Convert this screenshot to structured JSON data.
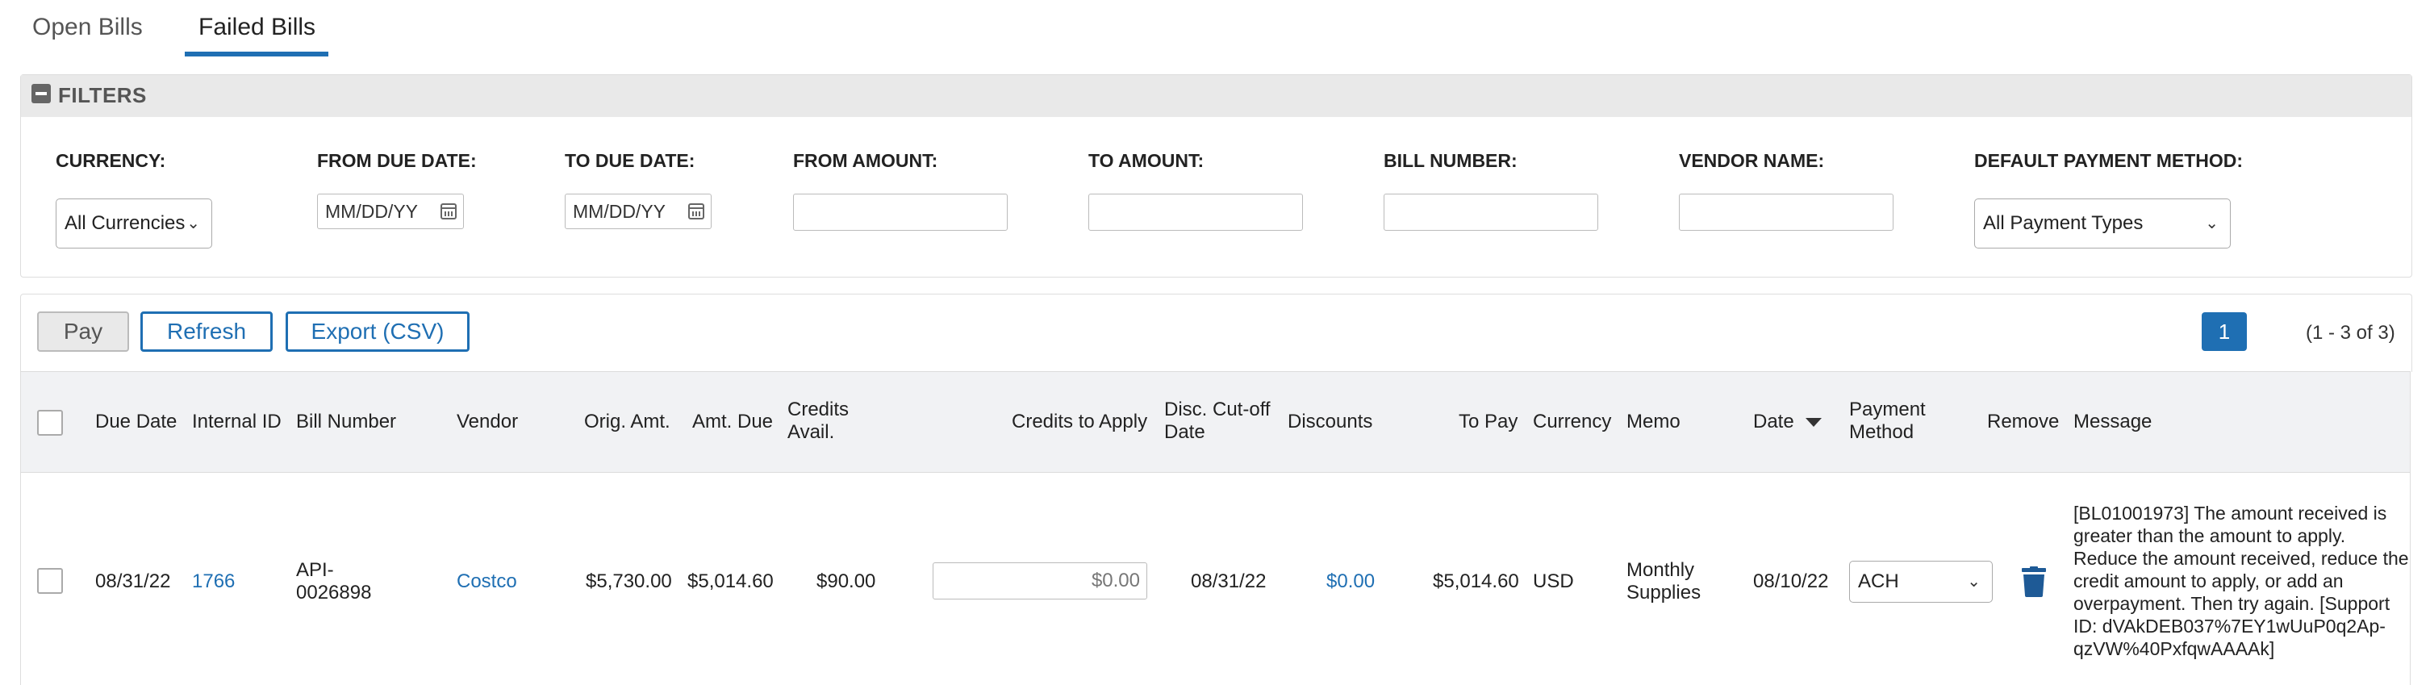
{
  "tabs": [
    {
      "label": "Open Bills",
      "active": false
    },
    {
      "label": "Failed Bills",
      "active": true
    }
  ],
  "filters": {
    "title": "FILTERS",
    "currency_label": "CURRENCY:",
    "currency_value": "All Currencies",
    "from_due_label": "FROM DUE DATE:",
    "from_due_placeholder": "MM/DD/YY",
    "to_due_label": "TO DUE DATE:",
    "to_due_placeholder": "MM/DD/YY",
    "from_amount_label": "FROM AMOUNT:",
    "to_amount_label": "TO AMOUNT:",
    "bill_number_label": "BILL NUMBER:",
    "vendor_name_label": "VENDOR NAME:",
    "payment_method_label": "DEFAULT PAYMENT METHOD:",
    "payment_method_value": "All Payment Types"
  },
  "toolbar": {
    "pay_label": "Pay",
    "refresh_label": "Refresh",
    "export_label": "Export (CSV)",
    "current_page": "1",
    "range_text": "(1 - 3 of 3)"
  },
  "table": {
    "headers": {
      "due_date": "Due Date",
      "internal_id": "Internal ID",
      "bill_number": "Bill Number",
      "vendor": "Vendor",
      "orig_amt": "Orig. Amt.",
      "amt_due": "Amt. Due",
      "credits_avail_1": "Credits",
      "credits_avail_2": "Avail.",
      "credits_to_apply": "Credits to Apply",
      "disc_cutoff_1": "Disc. Cut-off",
      "disc_cutoff_2": "Date",
      "discounts": "Discounts",
      "to_pay": "To Pay",
      "currency": "Currency",
      "memo": "Memo",
      "date": "Date",
      "payment_method_1": "Payment",
      "payment_method_2": "Method",
      "remove": "Remove",
      "message": "Message"
    },
    "rows": [
      {
        "due_date": "08/31/22",
        "internal_id": "1766",
        "bill_number_1": "API-",
        "bill_number_2": "0026898",
        "vendor": "Costco",
        "orig_amt": "$5,730.00",
        "amt_due": "$5,014.60",
        "credits_avail": "$90.00",
        "credits_to_apply": "$0.00",
        "disc_cutoff": "08/31/22",
        "discounts": "$0.00",
        "to_pay": "$5,014.60",
        "currency": "USD",
        "memo_1": "Monthly",
        "memo_2": "Supplies",
        "date": "08/10/22",
        "payment_method": "ACH",
        "message": "[BL01001973] The amount received is greater than the amount to apply. Reduce the amount received, reduce the credit amount to apply, or add an overpayment. Then try again. [Support ID: dVAkDEB037%7EY1wUuP0q2Ap-qzVW%40PxfqwAAAAk]"
      }
    ]
  },
  "colors": {
    "accent": "#1f6fb3",
    "header_bg": "#f1f2f4",
    "filter_header_bg": "#e9e9e9"
  }
}
